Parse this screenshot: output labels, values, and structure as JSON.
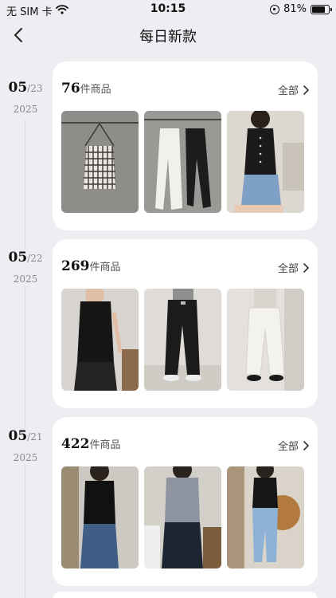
{
  "status": {
    "carrier": "无 SIM 卡",
    "time": "10:15",
    "battery": "81%",
    "battery_level": 0.81
  },
  "nav": {
    "title": "每日新款"
  },
  "days": [
    {
      "month": "05",
      "day": "/23",
      "year": "2025",
      "count": "76",
      "count_unit": "件商品",
      "all_label": "全部",
      "items": [
        {
          "name": "plaid-top-on-hanger",
          "bg": "#8f8d89",
          "fg": "#e9e6e0"
        },
        {
          "name": "white-and-black-pants-on-hangers",
          "bg": "#9b9996",
          "fg": "#f1f0ec"
        },
        {
          "name": "black-button-top-and-denim-shorts",
          "bg": "#dcd7d1",
          "fg": "#1a1a1a"
        }
      ]
    },
    {
      "month": "05",
      "day": "/22",
      "year": "2025",
      "count": "269",
      "count_unit": "件商品",
      "all_label": "全部",
      "items": [
        {
          "name": "black-cami-top-outfit",
          "bg": "#d8d4cf",
          "fg": "#151515"
        },
        {
          "name": "black-wide-leg-pants",
          "bg": "#dfdcd8",
          "fg": "#1b1b1b"
        },
        {
          "name": "white-wide-leg-pants",
          "bg": "#e4e1dc",
          "fg": "#f3f2ee"
        }
      ]
    },
    {
      "month": "05",
      "day": "/21",
      "year": "2025",
      "count": "422",
      "count_unit": "件商品",
      "all_label": "全部",
      "items": [
        {
          "name": "black-tank-and-jeans",
          "bg": "#cdc8c1",
          "fg": "#111111"
        },
        {
          "name": "grey-tank-and-dark-jeans",
          "bg": "#d3cfc9",
          "fg": "#8f95a0"
        },
        {
          "name": "black-tank-and-light-jeans",
          "bg": "#d9d3ca",
          "fg": "#161616"
        }
      ]
    }
  ]
}
